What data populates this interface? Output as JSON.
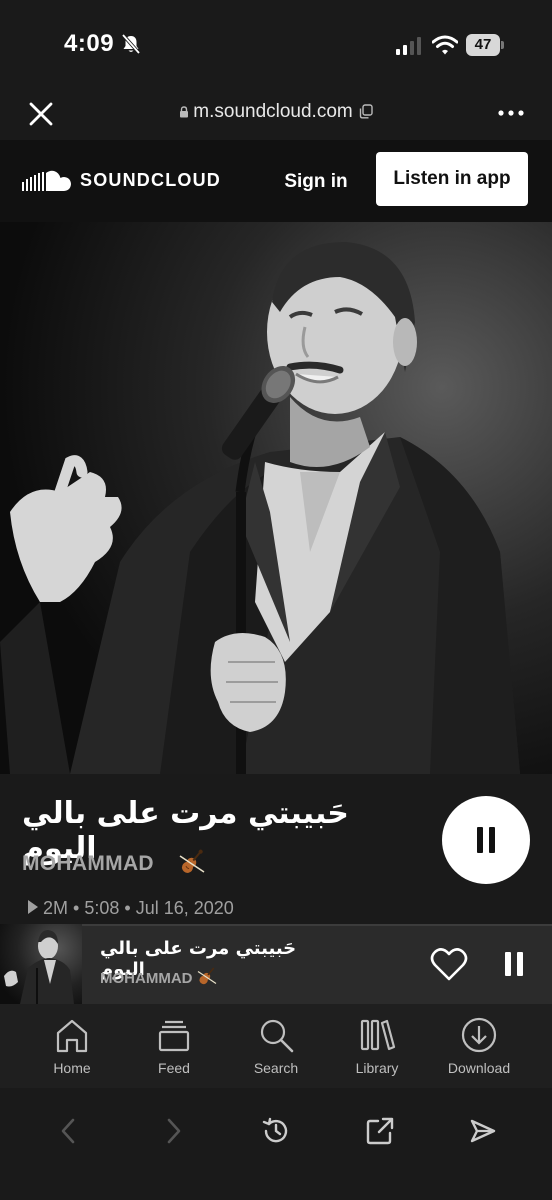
{
  "status_bar": {
    "time": "4:09",
    "battery": "47",
    "icons": [
      "bell-slash-icon",
      "cellular-signal-icon",
      "wifi-icon",
      "battery-icon"
    ]
  },
  "browser": {
    "url": "m.soundcloud.com",
    "toolbar_icons": [
      "back-icon",
      "forward-icon",
      "history-icon",
      "share-icon",
      "send-icon"
    ]
  },
  "header": {
    "logo_text": "SOUNDCLOUD",
    "sign_in_label": "Sign in",
    "listen_in_app_label": "Listen in app"
  },
  "track": {
    "title": "حَبيبتي مرت على بالي اليوم",
    "artist": "MOHAMMAD",
    "plays": "2M",
    "duration": "5:08",
    "date": "Jul 16, 2020",
    "meta_separator": " • ",
    "artwork": "black-and-white photo of a man singing into a microphone"
  },
  "mini_player": {
    "title": "حَبيبتي مرت على بالي اليوم",
    "artist": "MOHAMMAD",
    "progress_fraction": 0.015
  },
  "nav": {
    "items": [
      {
        "label": "Home",
        "icon": "home-icon"
      },
      {
        "label": "Feed",
        "icon": "feed-icon"
      },
      {
        "label": "Search",
        "icon": "search-icon"
      },
      {
        "label": "Library",
        "icon": "library-icon"
      },
      {
        "label": "Download",
        "icon": "download-icon"
      }
    ]
  },
  "colors": {
    "accent": "#ff5500",
    "background": "#1a1a1a",
    "header_bg": "#111111"
  }
}
